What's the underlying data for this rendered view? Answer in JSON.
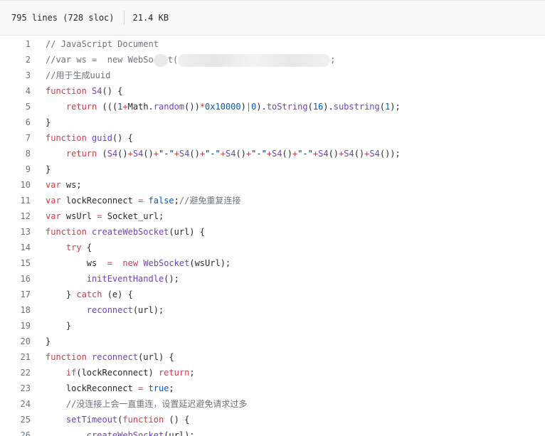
{
  "header": {
    "lines": "795 lines (728 sloc)",
    "size": "21.4 KB"
  },
  "code_lines": [
    {
      "n": "1",
      "parts": [
        [
          "c",
          "// JavaScript Document"
        ]
      ]
    },
    {
      "n": "2",
      "parts": [
        [
          "c",
          "//var ws =  new WebSo"
        ],
        [
          "blur-a",
          ""
        ],
        [
          "c",
          "t("
        ],
        [
          "blur-b",
          ""
        ],
        [
          "c",
          ";"
        ]
      ]
    },
    {
      "n": "3",
      "parts": [
        [
          "c",
          "//用于生成uuid"
        ]
      ]
    },
    {
      "n": "4",
      "parts": [
        [
          "k",
          "function"
        ],
        [
          "t",
          " "
        ],
        [
          "f",
          "S4"
        ],
        [
          "t",
          "() {"
        ]
      ]
    },
    {
      "n": "5",
      "parts": [
        [
          "t",
          "    "
        ],
        [
          "k",
          "return"
        ],
        [
          "t",
          " ((("
        ],
        [
          "n",
          "1"
        ],
        [
          "k",
          "+"
        ],
        [
          "t",
          "Math."
        ],
        [
          "f",
          "random"
        ],
        [
          "t",
          "())"
        ],
        [
          "k",
          "*"
        ],
        [
          "n",
          "0x10000"
        ],
        [
          "t",
          ")"
        ],
        [
          "k",
          "|"
        ],
        [
          "n",
          "0"
        ],
        [
          "t",
          ")."
        ],
        [
          "f",
          "toString"
        ],
        [
          "t",
          "("
        ],
        [
          "n",
          "16"
        ],
        [
          "t",
          ")."
        ],
        [
          "f",
          "substring"
        ],
        [
          "t",
          "("
        ],
        [
          "n",
          "1"
        ],
        [
          "t",
          ");"
        ]
      ]
    },
    {
      "n": "6",
      "parts": [
        [
          "t",
          "}"
        ]
      ]
    },
    {
      "n": "7",
      "parts": [
        [
          "k",
          "function"
        ],
        [
          "t",
          " "
        ],
        [
          "f",
          "guid"
        ],
        [
          "t",
          "() {"
        ]
      ]
    },
    {
      "n": "8",
      "parts": [
        [
          "t",
          "    "
        ],
        [
          "k",
          "return"
        ],
        [
          "t",
          " ("
        ],
        [
          "f",
          "S4"
        ],
        [
          "t",
          "()"
        ],
        [
          "k",
          "+"
        ],
        [
          "f",
          "S4"
        ],
        [
          "t",
          "()"
        ],
        [
          "k",
          "+"
        ],
        [
          "s",
          "\"-\""
        ],
        [
          "k",
          "+"
        ],
        [
          "f",
          "S4"
        ],
        [
          "t",
          "()"
        ],
        [
          "k",
          "+"
        ],
        [
          "s",
          "\"-\""
        ],
        [
          "k",
          "+"
        ],
        [
          "f",
          "S4"
        ],
        [
          "t",
          "()"
        ],
        [
          "k",
          "+"
        ],
        [
          "s",
          "\"-\""
        ],
        [
          "k",
          "+"
        ],
        [
          "f",
          "S4"
        ],
        [
          "t",
          "()"
        ],
        [
          "k",
          "+"
        ],
        [
          "s",
          "\"-\""
        ],
        [
          "k",
          "+"
        ],
        [
          "f",
          "S4"
        ],
        [
          "t",
          "()"
        ],
        [
          "k",
          "+"
        ],
        [
          "f",
          "S4"
        ],
        [
          "t",
          "()"
        ],
        [
          "k",
          "+"
        ],
        [
          "f",
          "S4"
        ],
        [
          "t",
          "());"
        ]
      ]
    },
    {
      "n": "9",
      "parts": [
        [
          "t",
          "}"
        ]
      ]
    },
    {
      "n": "10",
      "parts": [
        [
          "k",
          "var"
        ],
        [
          "t",
          " ws;"
        ]
      ]
    },
    {
      "n": "11",
      "parts": [
        [
          "k",
          "var"
        ],
        [
          "t",
          " lockReconnect "
        ],
        [
          "k",
          "="
        ],
        [
          "t",
          " "
        ],
        [
          "n",
          "false"
        ],
        [
          "t",
          ";"
        ],
        [
          "c",
          "//避免重复连接"
        ]
      ]
    },
    {
      "n": "12",
      "parts": [
        [
          "k",
          "var"
        ],
        [
          "t",
          " wsUrl "
        ],
        [
          "k",
          "="
        ],
        [
          "t",
          " Socket_url;"
        ]
      ]
    },
    {
      "n": "13",
      "parts": [
        [
          "k",
          "function"
        ],
        [
          "t",
          " "
        ],
        [
          "f",
          "createWebSocket"
        ],
        [
          "t",
          "(url) {"
        ]
      ]
    },
    {
      "n": "14",
      "parts": [
        [
          "t",
          "    "
        ],
        [
          "k",
          "try"
        ],
        [
          "t",
          " {"
        ]
      ]
    },
    {
      "n": "15",
      "parts": [
        [
          "t",
          "        ws  "
        ],
        [
          "k",
          "="
        ],
        [
          "t",
          "  "
        ],
        [
          "k",
          "new"
        ],
        [
          "t",
          " "
        ],
        [
          "f",
          "WebSocket"
        ],
        [
          "t",
          "(wsUrl);"
        ]
      ]
    },
    {
      "n": "16",
      "parts": [
        [
          "t",
          "        "
        ],
        [
          "f",
          "initEventHandle"
        ],
        [
          "t",
          "();"
        ]
      ]
    },
    {
      "n": "17",
      "parts": [
        [
          "t",
          "    } "
        ],
        [
          "k",
          "catch"
        ],
        [
          "t",
          " (e) {"
        ]
      ]
    },
    {
      "n": "18",
      "parts": [
        [
          "t",
          "        "
        ],
        [
          "f",
          "reconnect"
        ],
        [
          "t",
          "(url);"
        ]
      ]
    },
    {
      "n": "19",
      "parts": [
        [
          "t",
          "    }"
        ]
      ]
    },
    {
      "n": "20",
      "parts": [
        [
          "t",
          "}"
        ]
      ]
    },
    {
      "n": "21",
      "parts": [
        [
          "k",
          "function"
        ],
        [
          "t",
          " "
        ],
        [
          "f",
          "reconnect"
        ],
        [
          "t",
          "(url) {"
        ]
      ]
    },
    {
      "n": "22",
      "parts": [
        [
          "t",
          "    "
        ],
        [
          "k",
          "if"
        ],
        [
          "t",
          "(lockReconnect) "
        ],
        [
          "k",
          "return"
        ],
        [
          "t",
          ";"
        ]
      ]
    },
    {
      "n": "23",
      "parts": [
        [
          "t",
          "    lockReconnect "
        ],
        [
          "k",
          "="
        ],
        [
          "t",
          " "
        ],
        [
          "n",
          "true"
        ],
        [
          "t",
          ";"
        ]
      ]
    },
    {
      "n": "24",
      "parts": [
        [
          "t",
          "    "
        ],
        [
          "c",
          "//没连接上会一直重连，设置延迟避免请求过多"
        ]
      ]
    },
    {
      "n": "25",
      "parts": [
        [
          "t",
          "    "
        ],
        [
          "f",
          "setTimeout"
        ],
        [
          "t",
          "("
        ],
        [
          "k",
          "function"
        ],
        [
          "t",
          " () {"
        ]
      ]
    },
    {
      "n": "26",
      "parts": [
        [
          "t",
          "        "
        ],
        [
          "f",
          "createWebSocket"
        ],
        [
          "t",
          "(url);"
        ]
      ]
    }
  ]
}
